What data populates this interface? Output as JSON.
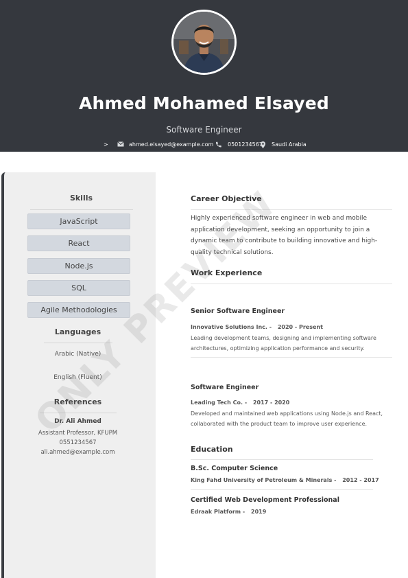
{
  "header": {
    "name": "Ahmed Mohamed Elsayed",
    "title": "Software Engineer",
    "contact": {
      "arrow": ">",
      "email": "ahmed.elsayed@example.com",
      "phone": "0501234567",
      "location": "Saudi Arabia"
    }
  },
  "sidebar": {
    "skills_heading": "Skills",
    "skills": [
      "JavaScript",
      "React",
      "Node.js",
      "SQL",
      "Agile Methodologies"
    ],
    "languages_heading": "Languages",
    "languages": [
      "Arabic (Native)",
      "English (Fluent)"
    ],
    "references_heading": "References",
    "reference": {
      "name": "Dr. Ali Ahmed",
      "role": "Assistant Professor, KFUPM",
      "phone": "0551234567",
      "email": "ali.ahmed@example.com"
    }
  },
  "main": {
    "objective_heading": "Career Objective",
    "objective_text": "Highly experienced software engineer in web and mobile application development, seeking an opportunity to join a dynamic team to contribute to building innovative and high-quality technical solutions.",
    "experience_heading": "Work Experience",
    "jobs": [
      {
        "title": "Senior Software Engineer",
        "company": "Innovative Solutions Inc. -",
        "period": "2020 - Present",
        "description": "Leading development teams, designing and implementing software architectures, optimizing application performance and security."
      },
      {
        "title": "Software Engineer",
        "company": "Leading Tech Co. -",
        "period": "2017 - 2020",
        "description": "Developed and maintained web applications using Node.js and React, collaborated with the product team to improve user experience."
      }
    ],
    "education_heading": "Education",
    "education": [
      {
        "degree": "B.Sc. Computer Science",
        "institution": "King Fahd University of Petroleum & Minerals -",
        "period": "2012 - 2017"
      },
      {
        "degree": "Certified Web Development Professional",
        "institution": "Edraak Platform -",
        "period": "2019"
      }
    ]
  },
  "watermark": "ONLY PREVIEW"
}
